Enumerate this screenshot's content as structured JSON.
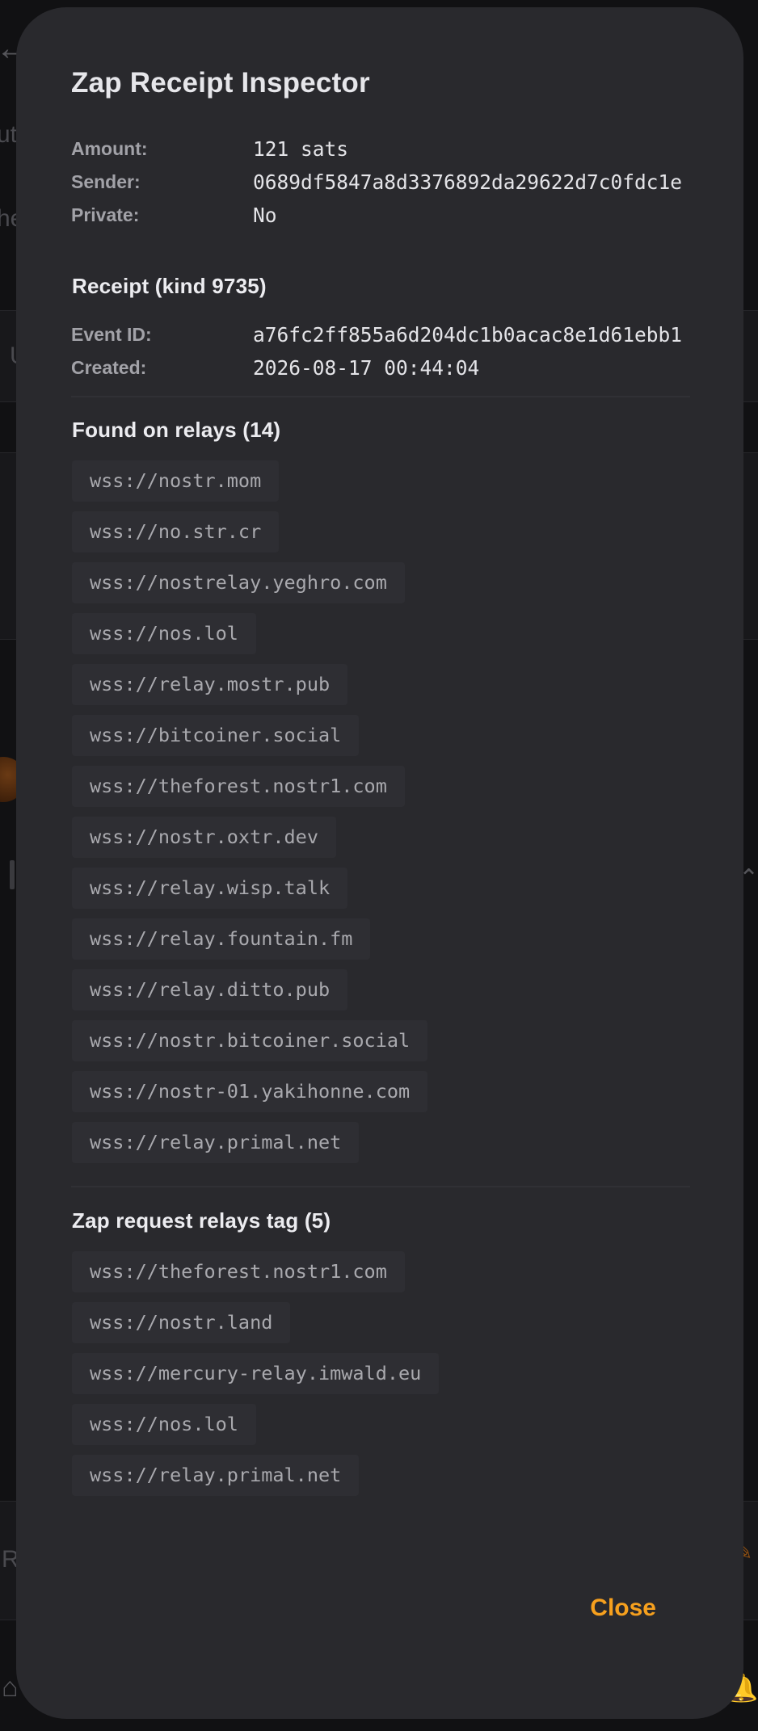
{
  "dialog": {
    "title": "Zap Receipt Inspector",
    "summary": [
      {
        "label": "Amount:",
        "value": "121 sats"
      },
      {
        "label": "Sender:",
        "value": "0689df5847a8d3376892da29622d7c0fdc1e"
      },
      {
        "label": "Private:",
        "value": "No"
      }
    ],
    "receipt": {
      "title": "Receipt (kind 9735)",
      "fields": [
        {
          "label": "Event ID:",
          "value": "a76fc2ff855a6d204dc1b0acac8e1d61ebb1"
        },
        {
          "label": "Created:",
          "value": "2026-08-17 00:44:04"
        }
      ]
    },
    "found_relays": {
      "title": "Found on relays (14)",
      "items": [
        "wss://nostr.mom",
        "wss://no.str.cr",
        "wss://nostrelay.yeghro.com",
        "wss://nos.lol",
        "wss://relay.mostr.pub",
        "wss://bitcoiner.social",
        "wss://theforest.nostr1.com",
        "wss://nostr.oxtr.dev",
        "wss://relay.wisp.talk",
        "wss://relay.fountain.fm",
        "wss://relay.ditto.pub",
        "wss://nostr.bitcoiner.social",
        "wss://nostr-01.yakihonne.com",
        "wss://relay.primal.net"
      ]
    },
    "request_relays": {
      "title": "Zap request relays tag (5)",
      "items": [
        "wss://theforest.nostr1.com",
        "wss://nostr.land",
        "wss://mercury-relay.imwald.eu",
        "wss://nos.lol",
        "wss://relay.primal.net"
      ]
    },
    "close_label": "Close"
  },
  "background": {
    "text_1": "ut",
    "text_2": "he",
    "text_3": "U",
    "text_4": "R"
  },
  "colors": {
    "dialog_bg": "#29292d",
    "accent": "#f6a01e",
    "chip_bg": "#2e2e33",
    "label": "#a2a2a8"
  },
  "icons": {
    "back": "arrow-left-icon",
    "home": "home-icon",
    "bell": "bell-icon",
    "pencil": "pencil-icon",
    "chevron": "chevron-up-icon"
  }
}
